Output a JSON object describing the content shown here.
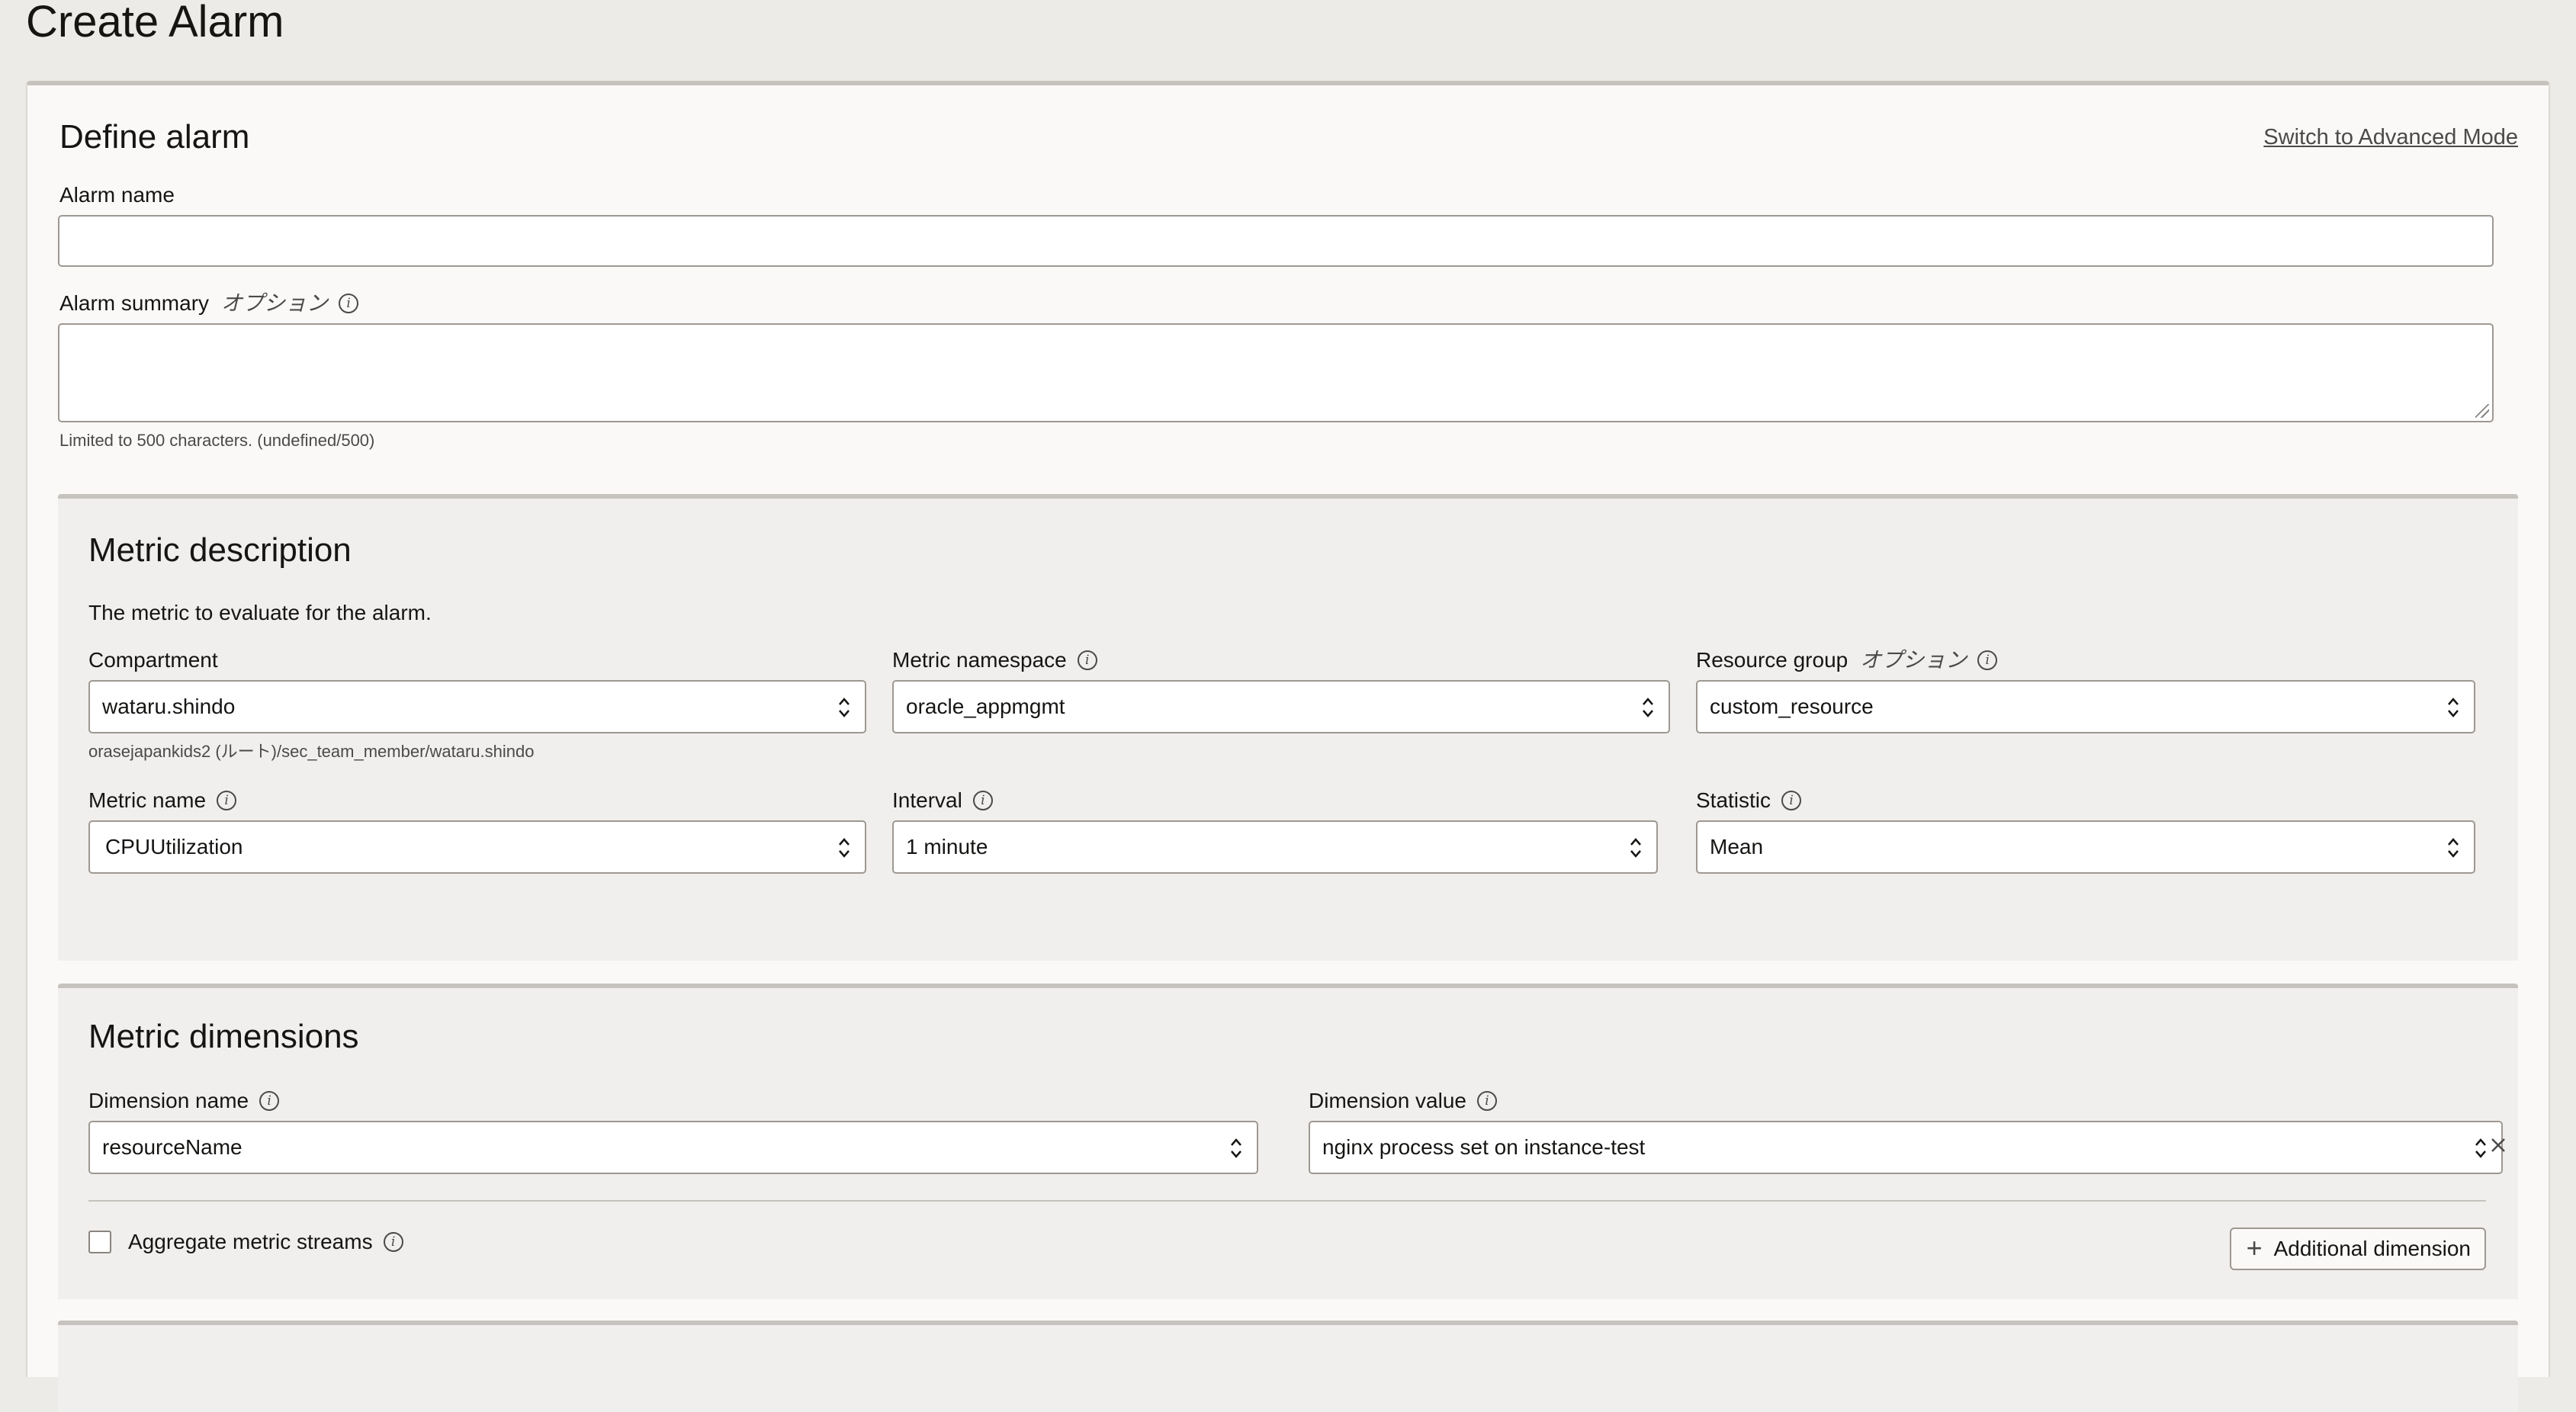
{
  "page": {
    "title": "Create Alarm"
  },
  "define_alarm": {
    "title": "Define alarm",
    "advanced_link": "Switch to Advanced Mode",
    "alarm_name": {
      "label": "Alarm name",
      "value": ""
    },
    "alarm_summary": {
      "label": "Alarm summary",
      "optional": "オプション",
      "value": "",
      "hint": "Limited to 500 characters. (undefined/500)"
    }
  },
  "metric_description": {
    "title": "Metric description",
    "description": "The metric to evaluate for the alarm.",
    "compartment": {
      "label": "Compartment",
      "value": "wataru.shindo",
      "path": "orasejapankids2 (ルート)/sec_team_member/wataru.shindo"
    },
    "metric_namespace": {
      "label": "Metric namespace",
      "value": "oracle_appmgmt"
    },
    "resource_group": {
      "label": "Resource group",
      "optional": "オプション",
      "value": "custom_resource"
    },
    "metric_name": {
      "label": "Metric name",
      "value": "CPUUtilization"
    },
    "interval": {
      "label": "Interval",
      "value": "1 minute"
    },
    "statistic": {
      "label": "Statistic",
      "value": "Mean"
    }
  },
  "metric_dimensions": {
    "title": "Metric dimensions",
    "dimension_name": {
      "label": "Dimension name",
      "value": "resourceName"
    },
    "dimension_value": {
      "label": "Dimension value",
      "value": "nginx process set on instance-test"
    },
    "aggregate": {
      "label": "Aggregate metric streams",
      "checked": false
    },
    "add_button": "Additional dimension"
  },
  "icons": {
    "info": "info-icon",
    "chevron": "up-down-chevron-icon",
    "close": "close-icon",
    "plus": "plus-icon"
  }
}
